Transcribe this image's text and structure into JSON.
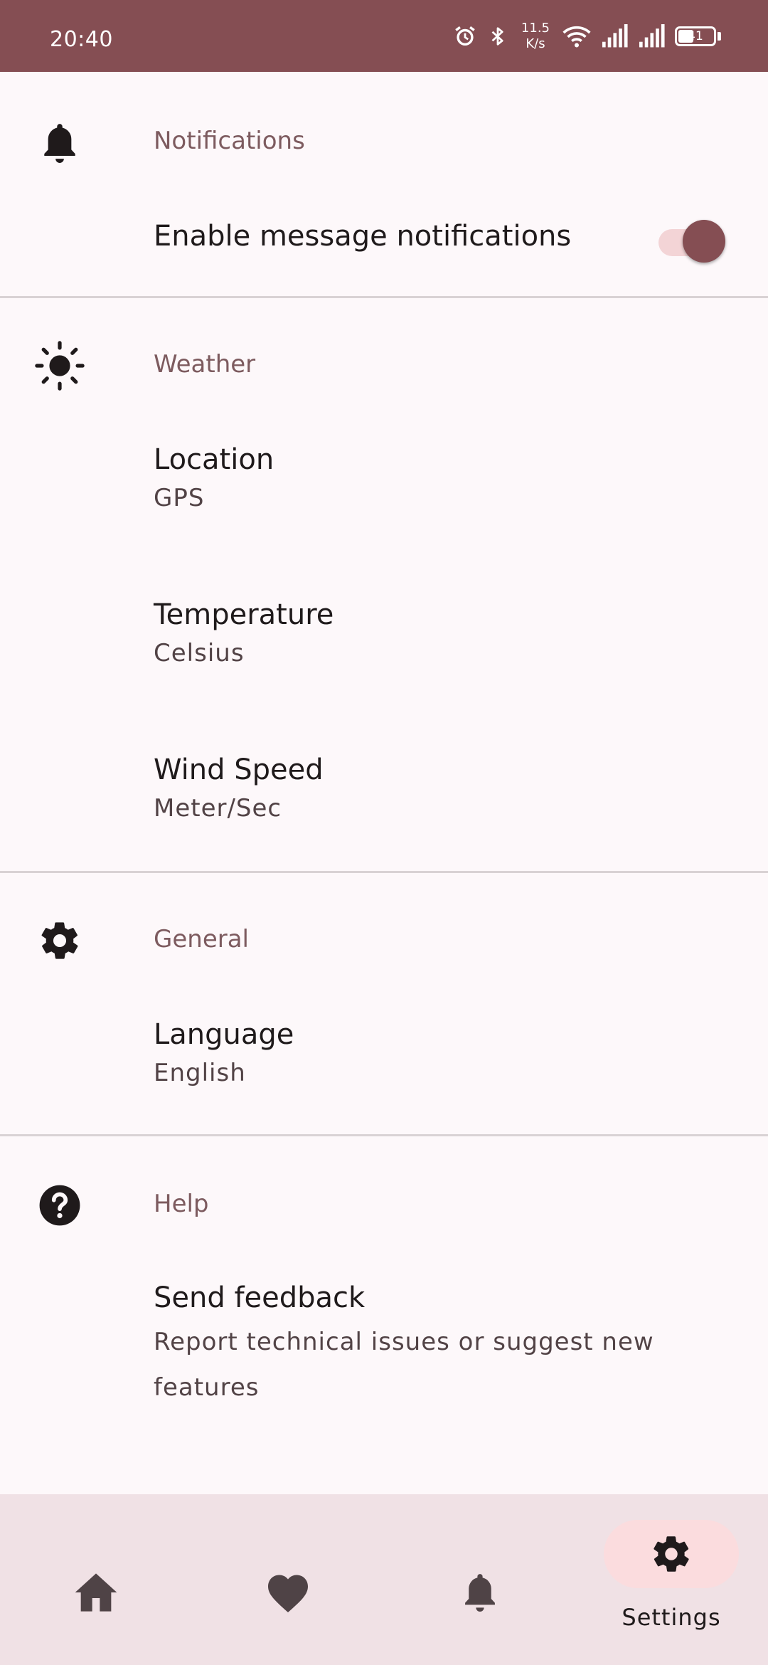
{
  "status_bar": {
    "time": "20:40",
    "net_speed_value": "11.5",
    "net_speed_unit": "K/s",
    "battery": "41",
    "icons": [
      "alarm-icon",
      "bluetooth-icon",
      "wifi-icon",
      "signal-icon",
      "signal-icon",
      "battery-icon"
    ]
  },
  "sections": {
    "notifications": {
      "icon": "bell-icon",
      "header": "Notifications",
      "items": [
        {
          "title": "Enable message notifications",
          "toggle_on": true
        }
      ]
    },
    "weather": {
      "icon": "sun-icon",
      "header": "Weather",
      "items": [
        {
          "title": "Location",
          "value": "GPS"
        },
        {
          "title": "Temperature",
          "value": "Celsius"
        },
        {
          "title": "Wind Speed",
          "value": "Meter/Sec"
        }
      ]
    },
    "general": {
      "icon": "gear-icon",
      "header": "General",
      "items": [
        {
          "title": "Language",
          "value": "English"
        }
      ]
    },
    "help": {
      "icon": "help-icon",
      "header": "Help",
      "items": [
        {
          "title": "Send feedback",
          "line1": "Report technical issues or suggest new",
          "line2": "features"
        }
      ]
    }
  },
  "bottom_nav": {
    "items": [
      {
        "icon": "home-icon",
        "label": ""
      },
      {
        "icon": "heart-icon",
        "label": ""
      },
      {
        "icon": "bell-icon",
        "label": ""
      },
      {
        "icon": "gear-icon",
        "label": "Settings",
        "active": true
      }
    ]
  },
  "colors": {
    "primary": "#854e53",
    "background": "#fdf8fa",
    "nav_background": "#f0e1e5",
    "active_pill": "#fbdcde",
    "toggle_track": "#f3d4d6"
  }
}
